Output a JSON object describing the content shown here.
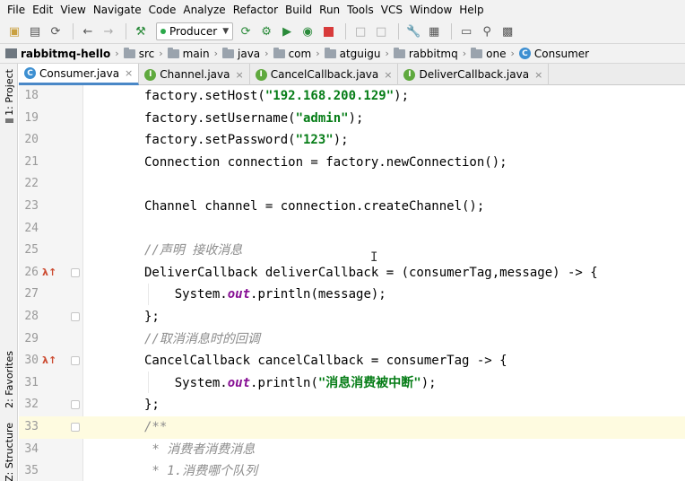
{
  "menu": [
    "File",
    "Edit",
    "View",
    "Navigate",
    "Code",
    "Analyze",
    "Refactor",
    "Build",
    "Run",
    "Tools",
    "VCS",
    "Window",
    "Help"
  ],
  "toolbar": {
    "run_config": "Producer"
  },
  "breadcrumb": {
    "project": "rabbitmq-hello",
    "parts": [
      "src",
      "main",
      "java",
      "com",
      "atguigu",
      "rabbitmq",
      "one"
    ],
    "class": "Consumer"
  },
  "side_tabs": {
    "project": "1: Project",
    "favorites": "2: Favorites",
    "structure": "Z: Structure"
  },
  "tabs": [
    {
      "label": "Consumer.java",
      "active": true,
      "icon": "C"
    },
    {
      "label": "Channel.java",
      "active": false,
      "icon": "I"
    },
    {
      "label": "CancelCallback.java",
      "active": false,
      "icon": "I"
    },
    {
      "label": "DeliverCallback.java",
      "active": false,
      "icon": "I"
    }
  ],
  "code": {
    "lines": [
      {
        "n": "18",
        "pre": "factory.setHost(",
        "str": "\"192.168.200.129\"",
        "post": ");"
      },
      {
        "n": "19",
        "pre": "factory.setUsername(",
        "str": "\"admin\"",
        "post": ");"
      },
      {
        "n": "20",
        "pre": "factory.setPassword(",
        "str": "\"123\"",
        "post": ");"
      },
      {
        "n": "21",
        "text": "Connection connection = factory.newConnection();"
      },
      {
        "n": "22",
        "text": ""
      },
      {
        "n": "23",
        "text": "Channel channel = connection.createChannel();"
      },
      {
        "n": "24",
        "text": ""
      },
      {
        "n": "25",
        "comment": "//声明 接收消息"
      },
      {
        "n": "26",
        "text": "DeliverCallback deliverCallback = (consumerTag,message) -> {"
      },
      {
        "n": "27",
        "pre": "    System.",
        "fld": "out",
        "post": ".println(message);"
      },
      {
        "n": "28",
        "text": "};"
      },
      {
        "n": "29",
        "comment": "//取消消息时的回调"
      },
      {
        "n": "30",
        "text": "CancelCallback cancelCallback = consumerTag -> {"
      },
      {
        "n": "31",
        "pre": "    System.",
        "fld": "out",
        "mid": ".println(",
        "str": "\"消息消费被中断\"",
        "post": ");"
      },
      {
        "n": "32",
        "text": "};"
      },
      {
        "n": "33",
        "comment": "/**"
      },
      {
        "n": "34",
        "comment": " * 消费者消费消息"
      },
      {
        "n": "35",
        "comment": " * 1.消费哪个队列"
      }
    ],
    "lambda_marker": "λ↑"
  }
}
